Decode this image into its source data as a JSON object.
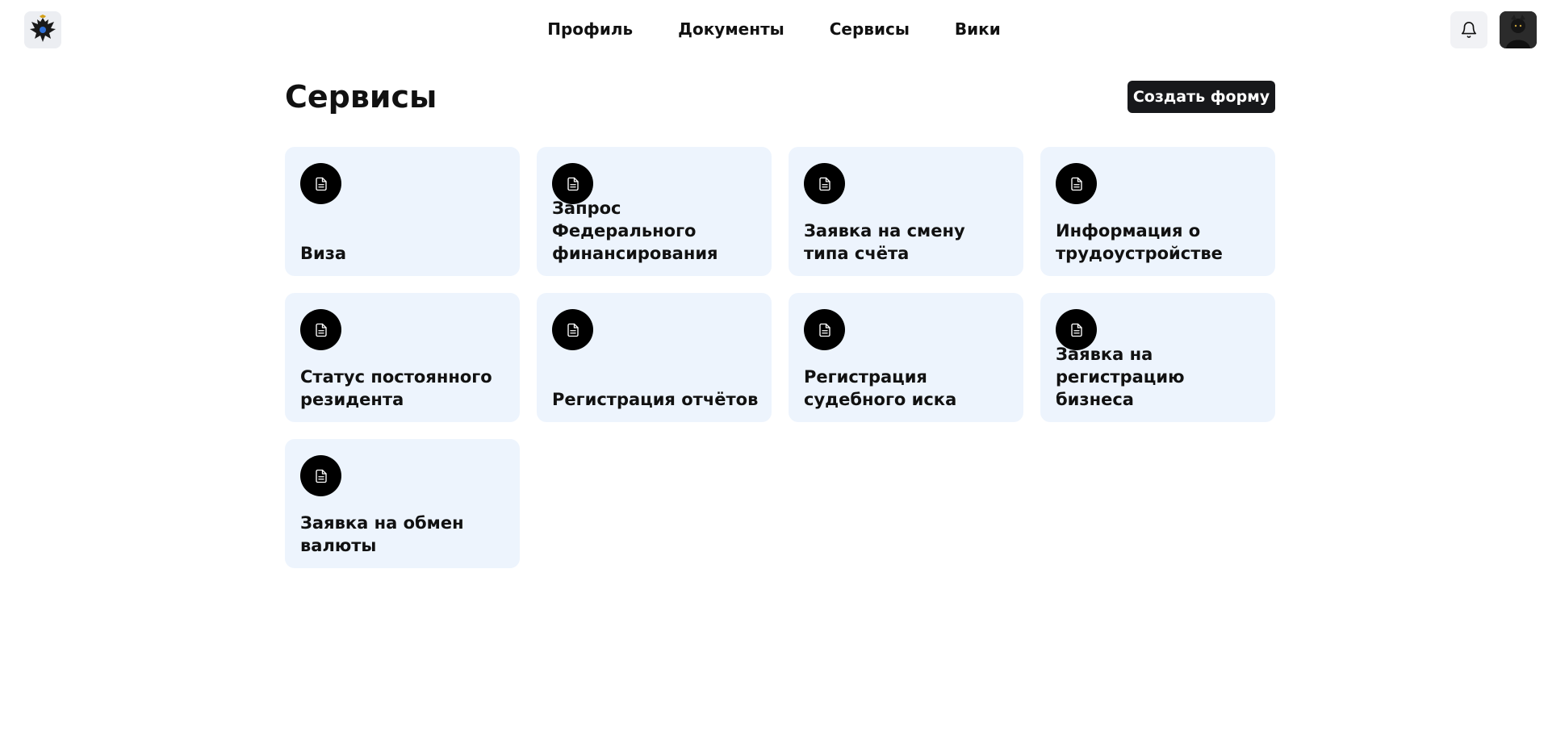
{
  "header": {
    "logo_icon": "eagle-emblem-icon",
    "nav": [
      {
        "label": "Профиль"
      },
      {
        "label": "Документы"
      },
      {
        "label": "Сервисы"
      },
      {
        "label": "Вики"
      }
    ],
    "notifications_icon": "bell-icon",
    "avatar_icon": "user-avatar"
  },
  "main": {
    "title": "Сервисы",
    "create_button_label": "Создать форму",
    "services": [
      {
        "label": "Виза",
        "icon": "document-icon"
      },
      {
        "label": "Запрос Федерального финансирования",
        "icon": "document-icon"
      },
      {
        "label": "Заявка на смену типа счёта",
        "icon": "document-icon"
      },
      {
        "label": "Информация о трудоустройстве",
        "icon": "document-icon"
      },
      {
        "label": "Статус постоянного резидента",
        "icon": "document-icon"
      },
      {
        "label": "Регистрация отчётов",
        "icon": "document-icon"
      },
      {
        "label": "Регистрация судебного иска",
        "icon": "document-icon"
      },
      {
        "label": "Заявка на регистрацию бизнеса",
        "icon": "document-icon"
      },
      {
        "label": "Заявка на обмен валюты",
        "icon": "document-icon"
      }
    ]
  },
  "colors": {
    "card_background": "#edf4fd",
    "button_background": "#17181b",
    "icon_circle": "#000000"
  }
}
